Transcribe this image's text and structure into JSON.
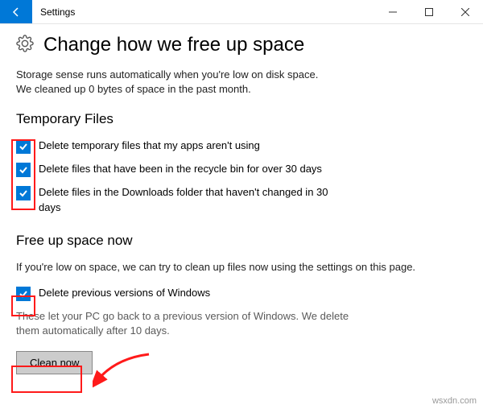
{
  "window": {
    "title": "Settings"
  },
  "page": {
    "title": "Change how we free up space",
    "description_line1": "Storage sense runs automatically when you're low on disk space.",
    "description_line2": "We cleaned up 0 bytes of space in the past month."
  },
  "section_temp": {
    "title": "Temporary Files",
    "opt1": "Delete temporary files that my apps aren't using",
    "opt2": "Delete files that have been in the recycle bin for over 30 days",
    "opt3": "Delete files in the Downloads folder that haven't changed in 30 days"
  },
  "section_free": {
    "title": "Free up space now",
    "desc": "If you're low on space, we can try to clean up files now using the settings on this page.",
    "opt4": "Delete previous versions of Windows",
    "sub": "These let your PC go back to a previous version of Windows. We delete them automatically after 10 days.",
    "button": "Clean now"
  },
  "watermark": "wsxdn.com"
}
